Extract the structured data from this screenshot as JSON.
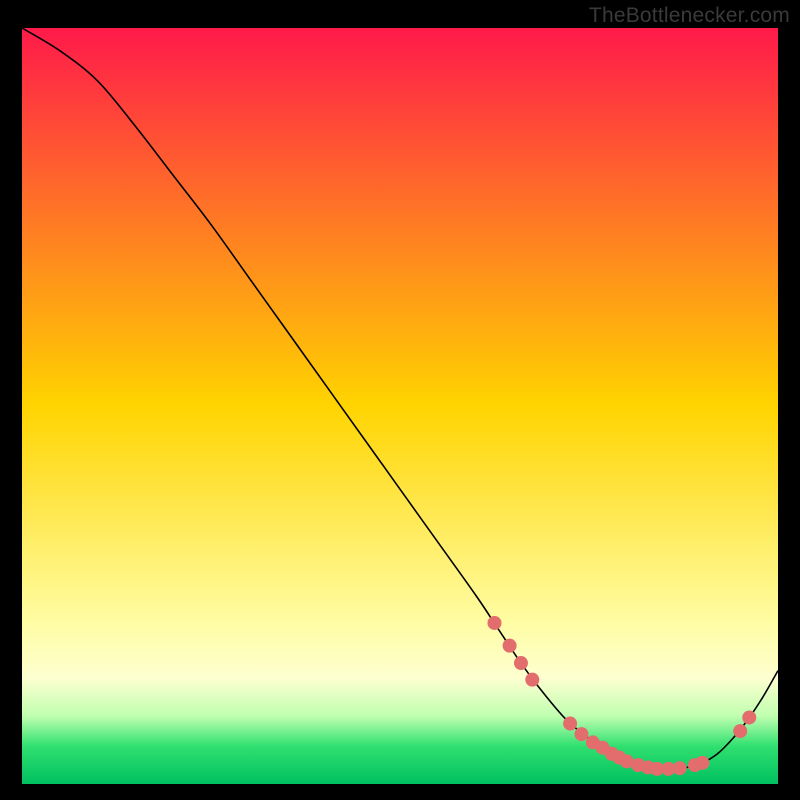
{
  "watermark": "TheBottlenecker.com",
  "chart_data": {
    "type": "line",
    "title": "",
    "xlabel": "",
    "ylabel": "",
    "xlim": [
      0,
      100
    ],
    "ylim": [
      0,
      100
    ],
    "background_gradient": [
      {
        "stop": 0.0,
        "color": "#ff1a4a"
      },
      {
        "stop": 0.5,
        "color": "#ffd400"
      },
      {
        "stop": 0.78,
        "color": "#fffca0"
      },
      {
        "stop": 0.86,
        "color": "#fdffd0"
      },
      {
        "stop": 0.91,
        "color": "#c0ffb0"
      },
      {
        "stop": 0.95,
        "color": "#30e070"
      },
      {
        "stop": 1.0,
        "color": "#00c060"
      }
    ],
    "series": [
      {
        "name": "bottleneck-curve",
        "color": "#000000",
        "stroke_width": 1.6,
        "x": [
          0,
          5,
          10,
          15,
          20,
          25,
          30,
          35,
          40,
          45,
          50,
          55,
          60,
          63,
          66,
          69,
          72,
          75,
          78,
          80,
          82,
          84,
          86,
          88,
          90,
          92,
          94,
          96,
          98,
          100
        ],
        "y": [
          100,
          97,
          93,
          87,
          80.5,
          74,
          67,
          60,
          53,
          46,
          39,
          32,
          25,
          20.5,
          16,
          12,
          8.5,
          6,
          4,
          3,
          2.3,
          2,
          2,
          2.2,
          2.8,
          4,
          6,
          8.5,
          11.5,
          15
        ]
      }
    ],
    "markers": {
      "name": "highlighted-dots",
      "color": "#e36c6c",
      "radius": 7,
      "points": [
        {
          "x": 62.5,
          "y": 21.3
        },
        {
          "x": 64.5,
          "y": 18.3
        },
        {
          "x": 66.0,
          "y": 16.0
        },
        {
          "x": 67.5,
          "y": 13.8
        },
        {
          "x": 72.5,
          "y": 8.0
        },
        {
          "x": 74.0,
          "y": 6.6
        },
        {
          "x": 75.5,
          "y": 5.5
        },
        {
          "x": 76.8,
          "y": 4.8
        },
        {
          "x": 78.0,
          "y": 4.0
        },
        {
          "x": 79.0,
          "y": 3.5
        },
        {
          "x": 80.0,
          "y": 3.0
        },
        {
          "x": 81.5,
          "y": 2.5
        },
        {
          "x": 82.8,
          "y": 2.2
        },
        {
          "x": 84.0,
          "y": 2.0
        },
        {
          "x": 85.5,
          "y": 2.0
        },
        {
          "x": 87.0,
          "y": 2.1
        },
        {
          "x": 89.0,
          "y": 2.5
        },
        {
          "x": 90.0,
          "y": 2.8
        },
        {
          "x": 95.0,
          "y": 7.0
        },
        {
          "x": 96.2,
          "y": 8.8
        }
      ]
    }
  }
}
